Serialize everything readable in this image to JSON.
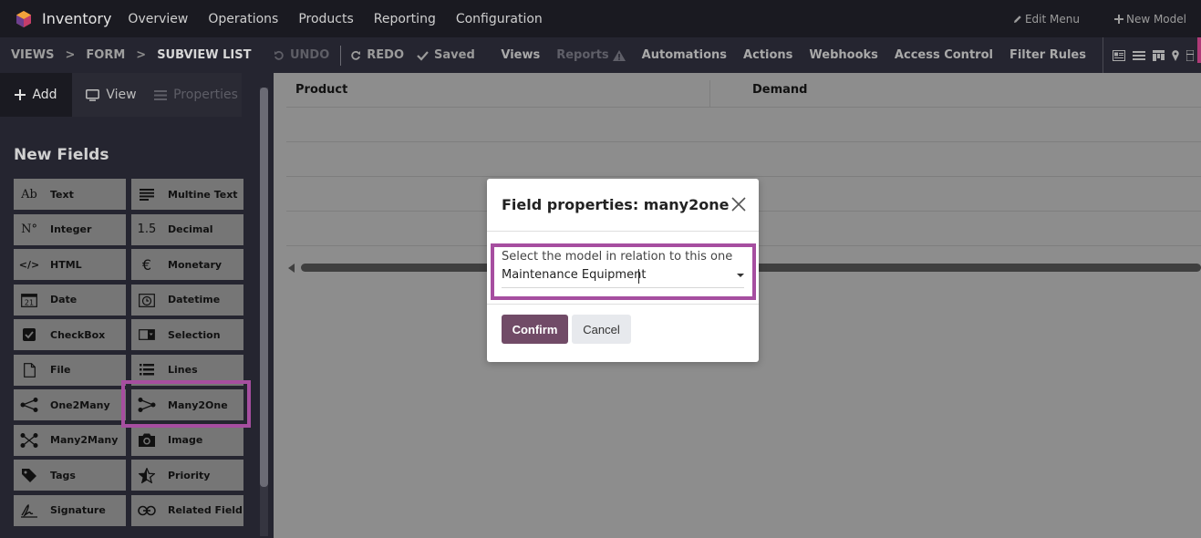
{
  "navbar": {
    "app_name": "Inventory",
    "menu": [
      "Overview",
      "Operations",
      "Products",
      "Reporting",
      "Configuration"
    ],
    "edit_menu": "Edit Menu",
    "new_model": "New Model"
  },
  "studio_bar": {
    "breadcrumbs": [
      "VIEWS",
      "FORM",
      "SUBVIEW LIST"
    ],
    "undo": "UNDO",
    "redo": "REDO",
    "saved": "Saved",
    "menu": [
      "Views",
      "Reports",
      "Automations",
      "Actions",
      "Webhooks",
      "Access Control",
      "Filter Rules"
    ]
  },
  "sidebar": {
    "tabs": {
      "add": "Add",
      "view": "View",
      "properties": "Properties"
    },
    "section_title": "New Fields",
    "fields": [
      {
        "label": "Text",
        "icon": "Ab"
      },
      {
        "label": "Multine Text",
        "icon": "text-lines-icon"
      },
      {
        "label": "Integer",
        "icon": "N°"
      },
      {
        "label": "Decimal",
        "icon": "1.5"
      },
      {
        "label": "HTML",
        "icon": "</>"
      },
      {
        "label": "Monetary",
        "icon": "€"
      },
      {
        "label": "Date",
        "icon": "21"
      },
      {
        "label": "Datetime",
        "icon": "clock-icon"
      },
      {
        "label": "CheckBox",
        "icon": "checkbox-icon"
      },
      {
        "label": "Selection",
        "icon": "selection-icon"
      },
      {
        "label": "File",
        "icon": "file-icon"
      },
      {
        "label": "Lines",
        "icon": "list-icon"
      },
      {
        "label": "One2Many",
        "icon": "one2many-icon"
      },
      {
        "label": "Many2One",
        "icon": "many2one-icon"
      },
      {
        "label": "Many2Many",
        "icon": "many2many-icon"
      },
      {
        "label": "Image",
        "icon": "camera-icon"
      },
      {
        "label": "Tags",
        "icon": "tag-icon"
      },
      {
        "label": "Priority",
        "icon": "star-icon"
      },
      {
        "label": "Signature",
        "icon": "signature-icon"
      },
      {
        "label": "Related Field",
        "icon": "link-icon"
      }
    ]
  },
  "list": {
    "columns": [
      "Product",
      "Demand"
    ]
  },
  "modal": {
    "title": "Field properties: many2one",
    "field_label": "Select the model in relation to this one",
    "field_value": "Maintenance Equipment",
    "confirm": "Confirm",
    "cancel": "Cancel"
  },
  "colors": {
    "navbar_bg": "#1a1a21",
    "primary": "#714b67",
    "highlight": "#a64ea0"
  }
}
